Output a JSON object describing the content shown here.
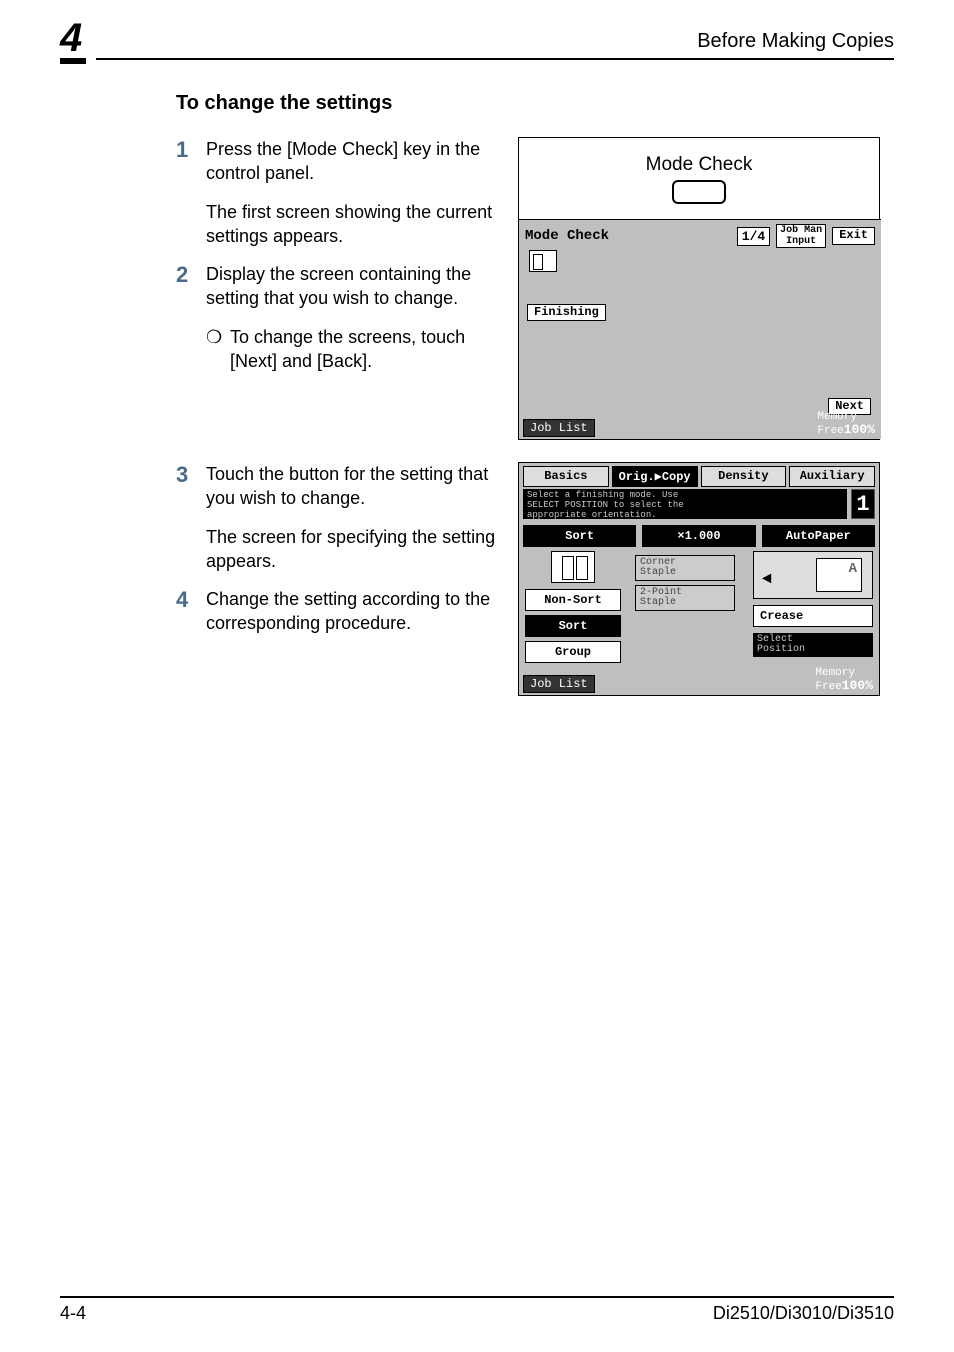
{
  "header": {
    "chapter_number": "4",
    "running_head": "Before Making Copies"
  },
  "section_title": "To change the settings",
  "steps": [
    {
      "num": "1",
      "text": "Press the [Mode Check] key in the control panel.",
      "body": "The first screen showing the current settings appears."
    },
    {
      "num": "2",
      "text": "Display the screen containing the setting that you wish to change.",
      "bullet": "To change the screens, touch [Next] and [Back]."
    },
    {
      "num": "3",
      "text": "Touch the button for the setting that you wish to change.",
      "body": "The screen for specifying the setting appears."
    },
    {
      "num": "4",
      "text": "Change the setting according to the corresponding procedure."
    }
  ],
  "figure1": {
    "caption": "Mode Check",
    "title": "Mode Check",
    "page_indicator": "1/4",
    "job_man_input": "Job Man\nInput",
    "exit": "Exit",
    "finishing": "Finishing",
    "next": "Next",
    "job_list": "Job List",
    "memory_label": "Memory\nFree",
    "memory_value": "100%"
  },
  "figure2": {
    "tabs": [
      "Basics",
      "Orig.▶Copy",
      "Density",
      "Auxiliary"
    ],
    "selected_tab_index": 1,
    "message": "Select a finishing mode. Use\nSELECT POSITION to select the\nappropriate orientation.",
    "count": "1",
    "row3": {
      "sort": "Sort",
      "zoom": "×1.000",
      "autopaper": "AutoPaper"
    },
    "left_options": [
      "Non-Sort",
      "Sort",
      "Group"
    ],
    "mid_options": [
      "Corner\nStaple",
      "2-Point\nStaple"
    ],
    "right": {
      "crease": "Crease",
      "select_position": "Select\nPosition"
    },
    "job_list": "Job List",
    "memory_label": "Memory\nFree",
    "memory_value": "100%"
  },
  "footer": {
    "page_number": "4-4",
    "model": "Di2510/Di3010/Di3510"
  }
}
